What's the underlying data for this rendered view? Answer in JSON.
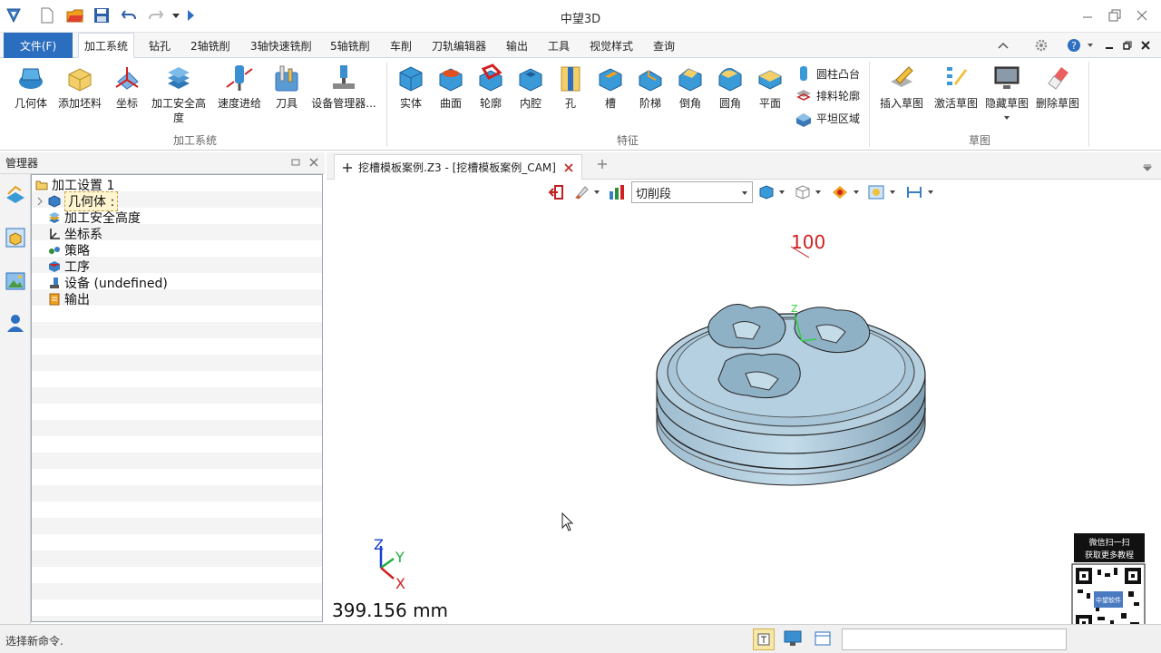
{
  "app": {
    "title": "中望3D"
  },
  "menu": {
    "file": "文件(F)",
    "tabs": [
      "加工系统",
      "钻孔",
      "2轴铣削",
      "3轴快速铣削",
      "5轴铣削",
      "车削",
      "刀轨编辑器",
      "输出",
      "工具",
      "视觉样式",
      "查询"
    ]
  },
  "ribbon": {
    "machining": {
      "label": "加工系统",
      "buttons": [
        "几何体",
        "添加坯料",
        "坐标",
        "加工安全高\n度",
        "速度进给",
        "刀具",
        "设备管理器..."
      ]
    },
    "features": {
      "label": "特征",
      "buttons": [
        "实体",
        "曲面",
        "轮廓",
        "内腔",
        "孔",
        "槽",
        "阶梯",
        "倒角",
        "圆角",
        "平面"
      ],
      "small": [
        "圆柱凸台",
        "排料轮廓",
        "平坦区域"
      ]
    },
    "sketch": {
      "label": "草图",
      "buttons": [
        "插入草图",
        "激活草图",
        "隐藏草图",
        "删除草图"
      ]
    }
  },
  "manager": {
    "title": "管理器",
    "tree": {
      "root": "加工设置 1",
      "children": [
        "几何体 :",
        "加工安全高度",
        "坐标系",
        "策略",
        "工序",
        "设备 (undefined)",
        "输出"
      ]
    }
  },
  "document": {
    "tab": "挖槽模板案例.Z3 - [挖槽模板案例_CAM]"
  },
  "viewtoolbar": {
    "select_value": "切削段"
  },
  "viewport": {
    "dimension": "100",
    "scale": "399.156 mm",
    "axis": {
      "x": "X",
      "y": "Y",
      "z": "Z"
    },
    "model_axis": "Z"
  },
  "qr": {
    "line1": "微信扫一扫",
    "line2": "获取更多教程",
    "center": "中望软件"
  },
  "status": {
    "text": "选择新命令."
  },
  "colors": {
    "accent": "#2b6dbf",
    "part": "#a9c6d8"
  }
}
